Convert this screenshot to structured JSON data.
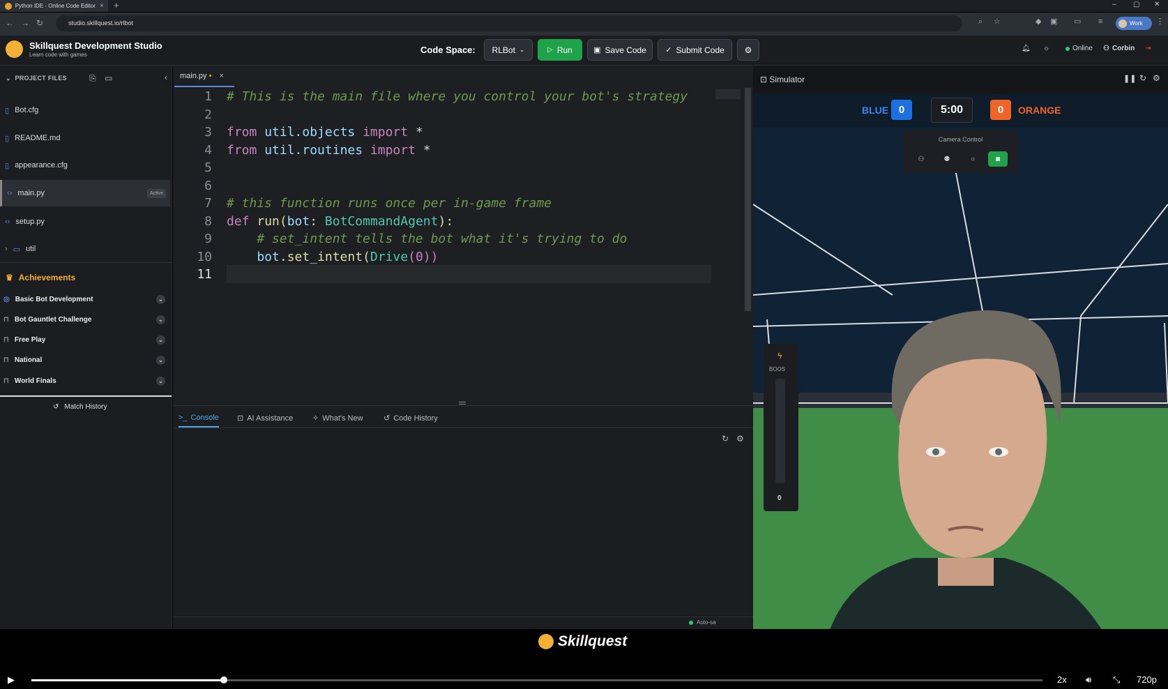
{
  "browser": {
    "tab_title": "Python IDE - Online Code Editor",
    "new_tab": "+",
    "url": "studio.skillquest.io/rlbot",
    "profile": "Work"
  },
  "app": {
    "brand": "Skillquest Development Studio",
    "tagline": "Learn code with games",
    "code_space_label": "Code Space:",
    "code_space_value": "RLBot",
    "run": "Run",
    "save": "Save Code",
    "submit": "Submit Code",
    "status": "Online",
    "user": "Corbin"
  },
  "sidebar": {
    "header": "PROJECT FILES",
    "files": [
      {
        "name": "Bot.cfg"
      },
      {
        "name": "README.md"
      },
      {
        "name": "appearance.cfg"
      },
      {
        "name": "main.py",
        "badge": "Active"
      },
      {
        "name": "setup.py"
      },
      {
        "name": "util"
      }
    ],
    "achievements_title": "Achievements",
    "achievements": [
      "Basic Bot Development",
      "Bot Gauntlet Challenge",
      "Free Play",
      "National",
      "World Finals"
    ],
    "match_history": "Match History"
  },
  "editor": {
    "tab": "main.py",
    "tab_modified": "•",
    "tab_close": "×",
    "line_numbers": [
      "1",
      "2",
      "3",
      "4",
      "5",
      "6",
      "7",
      "8",
      "9",
      "10",
      "11"
    ],
    "code": {
      "l1": "# This is the main file where you control your bot's strategy",
      "l3_kw1": "from",
      "l3_mod": " util.objects ",
      "l3_kw2": "import",
      "l3_rest": " *",
      "l4_kw1": "from",
      "l4_mod": " util.routines ",
      "l4_kw2": "import",
      "l4_rest": " *",
      "l7": "# this function runs once per in-game frame",
      "l8_kw": "def",
      "l8_fn": " run",
      "l8_p1": "(",
      "l8_arg": "bot",
      "l8_p2": ": ",
      "l8_type": "BotCommandAgent",
      "l8_p3": "):",
      "l9": "    # set_intent tells the bot what it's trying to do",
      "l10_obj": "    bot",
      "l10_dot": ".",
      "l10_fn": "set_intent",
      "l10_p1": "(",
      "l10_cls": "Drive",
      "l10_p2": "(0))"
    }
  },
  "bottom_tabs": {
    "console": "Console",
    "ai": "AI Assistance",
    "whats_new": "What's New",
    "history": "Code History",
    "autosave": "Auto-sa"
  },
  "simulator": {
    "title": "Simulator",
    "blue_label": "BLUE",
    "blue_score": "0",
    "timer": "5:00",
    "orange_score": "0",
    "orange_label": "ORANGE",
    "camera_label": "Camera Control",
    "boost_label": "BOOS",
    "boost_value": "0"
  },
  "footer": {
    "logo_text": "Skillquest"
  },
  "player": {
    "progress": 0.19,
    "speed": "2x",
    "quality": "720p"
  },
  "colors": {
    "accent_green": "#1ea34a",
    "accent_gold": "#f2b134",
    "blue_team": "#1e6fe0",
    "orange_team": "#f0642a",
    "tab_active": "#4aa8e8"
  }
}
